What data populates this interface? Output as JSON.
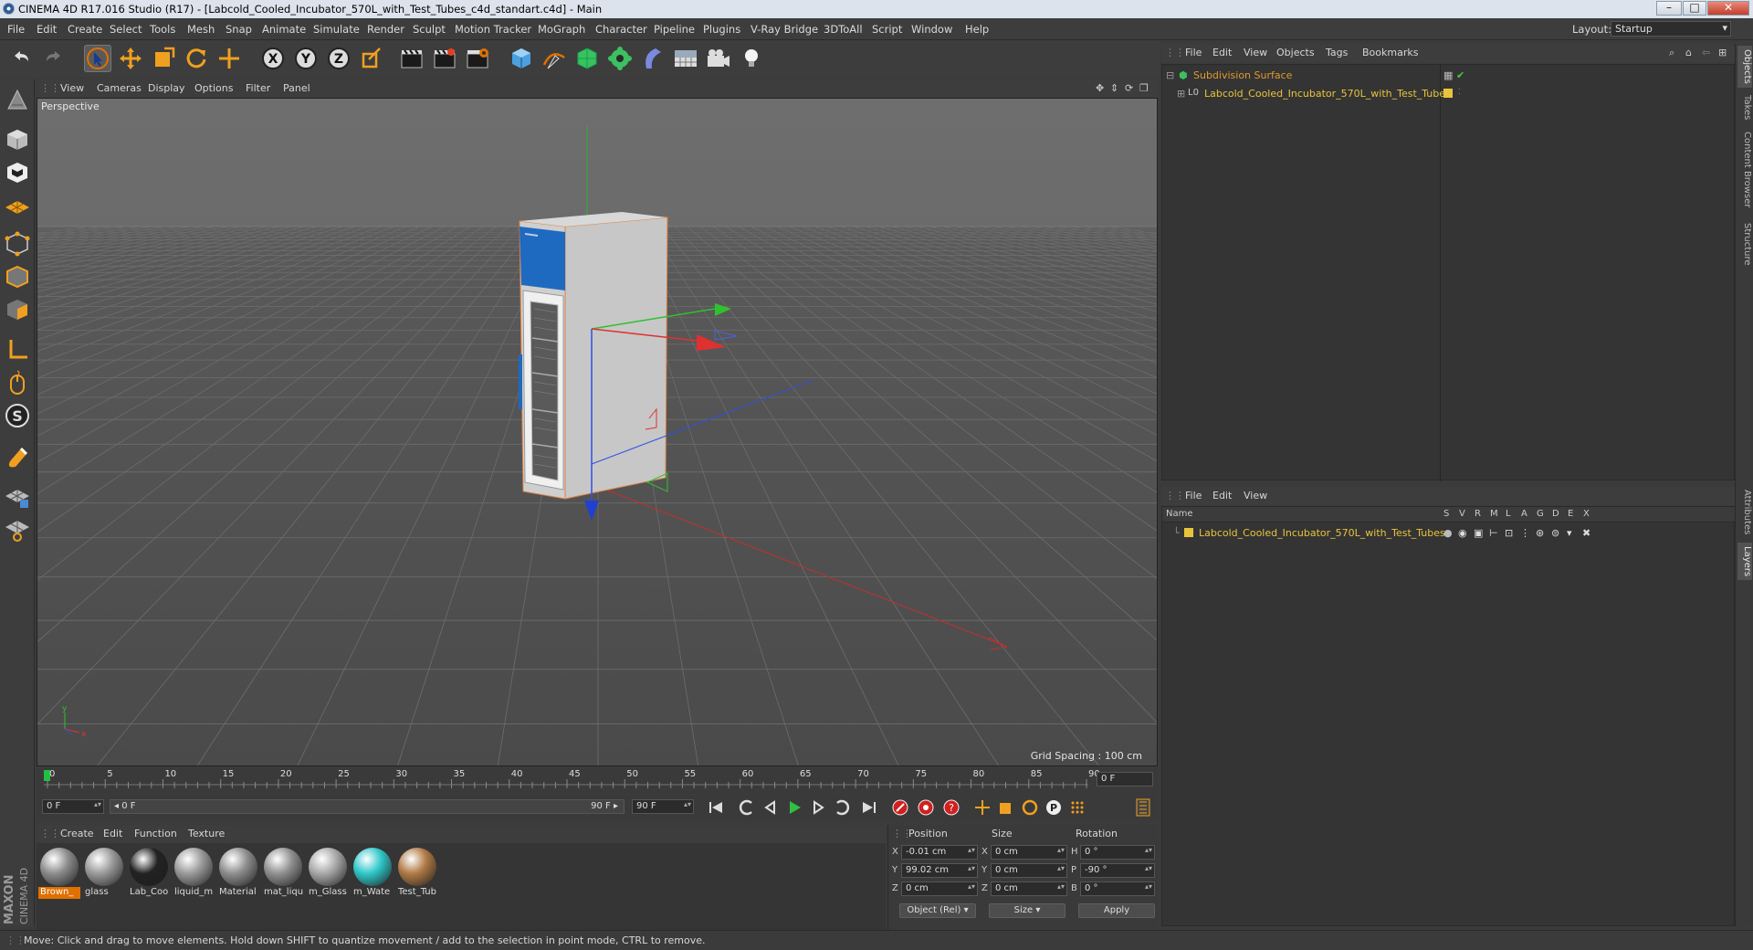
{
  "window": {
    "title": "CINEMA 4D R17.016 Studio (R17) - [Labcold_Cooled_Incubator_570L_with_Test_Tubes_c4d_standart.c4d] - Main",
    "controls": {
      "minimize": "–",
      "maximize": "□",
      "close": "✕"
    }
  },
  "menubar": {
    "items": [
      "File",
      "Edit",
      "Create",
      "Select",
      "Tools",
      "Mesh",
      "Snap",
      "Animate",
      "Simulate",
      "Render",
      "Sculpt",
      "Motion Tracker",
      "MoGraph",
      "Character",
      "Pipeline",
      "Plugins",
      "V-Ray Bridge",
      "3DToAll",
      "Script",
      "Window",
      "Help"
    ],
    "layout_label": "Layout:",
    "layout_value": "Startup"
  },
  "viewport": {
    "menu": [
      "View",
      "Cameras",
      "Display",
      "Options",
      "Filter",
      "Panel"
    ],
    "label": "Perspective",
    "grid_spacing": "Grid Spacing : 100 cm"
  },
  "timeline": {
    "ticks": [
      "0",
      "5",
      "10",
      "15",
      "20",
      "25",
      "30",
      "35",
      "40",
      "45",
      "50",
      "55",
      "60",
      "65",
      "70",
      "75",
      "80",
      "85",
      "90"
    ],
    "end_field": "0 F",
    "start_field": "0 F",
    "range_start": "◂ 0 F",
    "range_end": "90 F ▸",
    "max_field": "90 F"
  },
  "materials": {
    "menu": [
      "Create",
      "Edit",
      "Function",
      "Texture"
    ],
    "items": [
      {
        "label": "Brown_",
        "color": "#8c8c8c",
        "selected": true
      },
      {
        "label": "glass",
        "color": "#9a9a9a"
      },
      {
        "label": "Lab_Coo",
        "color": "#222222"
      },
      {
        "label": "liquid_m",
        "color": "#9a9a9a"
      },
      {
        "label": "Material",
        "color": "#8e8e8e"
      },
      {
        "label": "mat_liqu",
        "color": "#909090"
      },
      {
        "label": "m_Glass",
        "color": "#a8a8a8"
      },
      {
        "label": "m_Wate",
        "color": "#2fc7c9"
      },
      {
        "label": "Test_Tub",
        "color": "#b07a45"
      }
    ]
  },
  "coordinates": {
    "headers": [
      "Position",
      "Size",
      "Rotation"
    ],
    "rows": [
      {
        "axis": "X",
        "pos": "-0.01 cm",
        "size_axis": "X",
        "size": "0 cm",
        "rot_axis": "H",
        "rot": "0 °"
      },
      {
        "axis": "Y",
        "pos": "99.02 cm",
        "size_axis": "Y",
        "size": "0 cm",
        "rot_axis": "P",
        "rot": "-90 °"
      },
      {
        "axis": "Z",
        "pos": "0 cm",
        "size_axis": "Z",
        "size": "0 cm",
        "rot_axis": "B",
        "rot": "0 °"
      }
    ],
    "mode": "Object (Rel)",
    "size_mode": "Size",
    "apply": "Apply"
  },
  "object_manager": {
    "menu": [
      "File",
      "Edit",
      "View",
      "Objects",
      "Tags",
      "Bookmarks"
    ],
    "rows": [
      {
        "name": "Subdivision Surface",
        "color": "#e09a2c"
      },
      {
        "name": "Labcold_Cooled_Incubator_570L_with_Test_Tubes",
        "color": "#e8c43c"
      }
    ]
  },
  "layer_manager": {
    "menu": [
      "File",
      "Edit",
      "View"
    ],
    "columns": [
      "Name",
      "S",
      "V",
      "R",
      "M",
      "L",
      "A",
      "G",
      "D",
      "E",
      "X"
    ],
    "rows": [
      {
        "name": "Labcold_Cooled_Incubator_570L_with_Test_Tubes",
        "color": "#e8c43c"
      }
    ]
  },
  "side_tabs": [
    "Objects",
    "Takes",
    "Content Browser",
    "Structure",
    "Attributes",
    "Layers"
  ],
  "status": {
    "text": "Move: Click and drag to move elements. Hold down SHIFT to quantize movement / add to the selection in point mode, CTRL to remove."
  },
  "branding": {
    "logo": "MAXON CINEMA 4D"
  },
  "colors": {
    "accent": "#e07000",
    "x_axis": "#e03030",
    "y_axis": "#30c030",
    "z_axis": "#3050e0",
    "object_name": "#e8c43c"
  }
}
